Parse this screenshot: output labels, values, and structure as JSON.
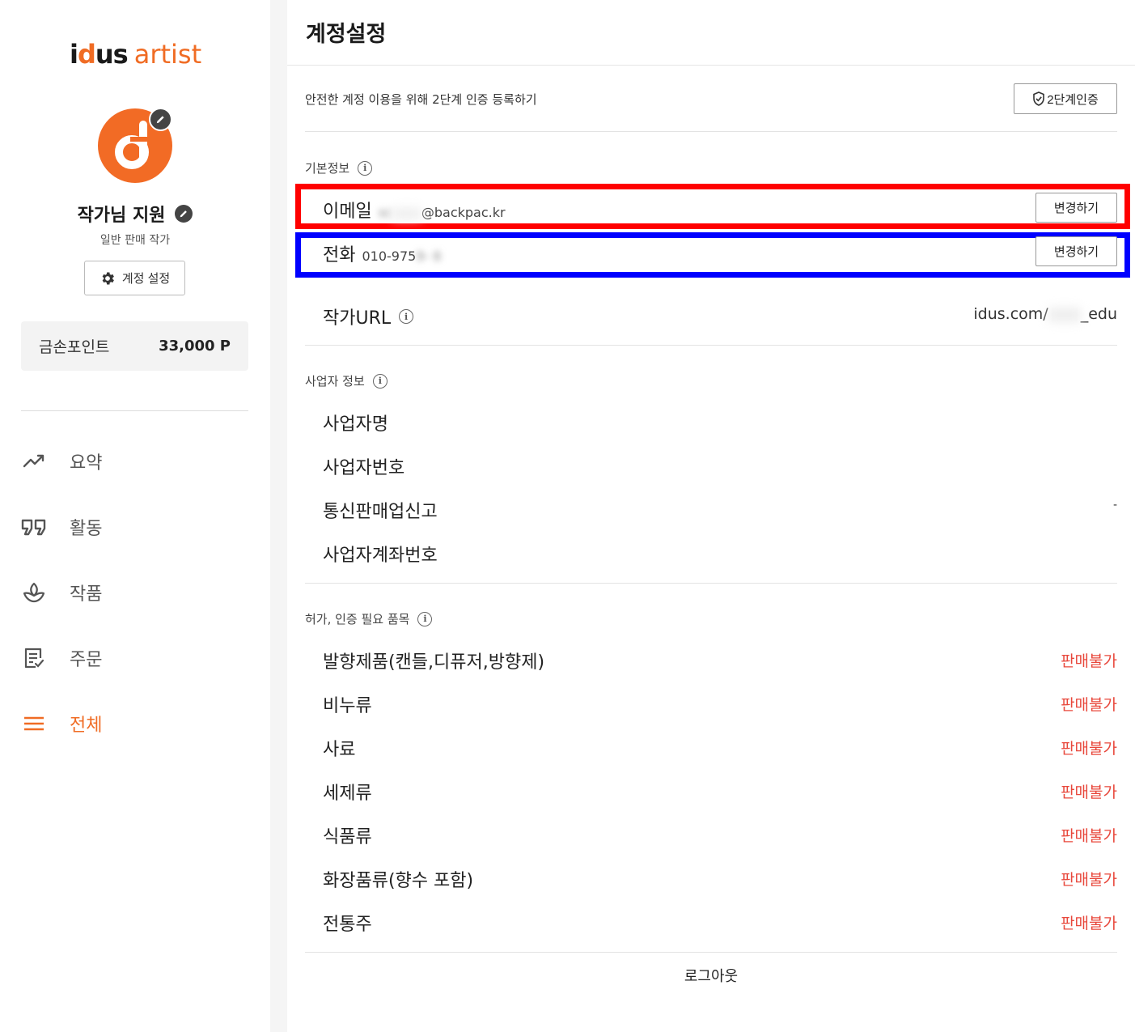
{
  "sidebar": {
    "logo": {
      "brand_prefix": "i",
      "brand_o": "d",
      "brand_suffix": "us",
      "brand_word": "artist"
    },
    "profile": {
      "name": "작가님 지원",
      "role": "일반 판매 작가"
    },
    "account_button": "계정 설정",
    "points": {
      "label": "금손포인트",
      "value": "33,000 P"
    },
    "nav": [
      {
        "label": "요약",
        "icon": "trending-up-icon"
      },
      {
        "label": "활동",
        "icon": "quote-icon"
      },
      {
        "label": "작품",
        "icon": "plant-icon"
      },
      {
        "label": "주문",
        "icon": "order-list-icon"
      },
      {
        "label": "전체",
        "icon": "menu-icon"
      }
    ],
    "accent": "#f06c24"
  },
  "main": {
    "title": "계정설정",
    "twofa": {
      "text": "안전한 계정 이용을 위해 2단계 인증 등록하기",
      "button": "2단계인증"
    },
    "basic": {
      "title": "기본정보",
      "email": {
        "label": "이메일",
        "value_masked": "sc",
        "value": "@backpac.kr",
        "button": "변경하기"
      },
      "phone": {
        "label": "전화",
        "value": "010-975",
        "value_masked": "9-  6",
        "button": "변경하기"
      },
      "url": {
        "label": "작가URL",
        "value": "idus.com/",
        "value_masked": "   ",
        "value_end": "_edu"
      }
    },
    "business": {
      "title": "사업자 정보",
      "rows": [
        {
          "label": "사업자명",
          "value": ""
        },
        {
          "label": "사업자번호",
          "value": ""
        },
        {
          "label": "통신판매업신고",
          "value": "-"
        },
        {
          "label": "사업자계좌번호",
          "value": ""
        }
      ]
    },
    "permits": {
      "title": "허가, 인증 필요 품목",
      "rows": [
        {
          "label": "발향제품(캔들,디퓨저,방향제)",
          "status": "판매불가"
        },
        {
          "label": "비누류",
          "status": "판매불가"
        },
        {
          "label": "사료",
          "status": "판매불가"
        },
        {
          "label": "세제류",
          "status": "판매불가"
        },
        {
          "label": "식품류",
          "status": "판매불가"
        },
        {
          "label": "화장품류(향수 포함)",
          "status": "판매불가"
        },
        {
          "label": "전통주",
          "status": "판매불가"
        }
      ]
    },
    "logout": "로그아웃",
    "status_color": "#e8483c"
  }
}
